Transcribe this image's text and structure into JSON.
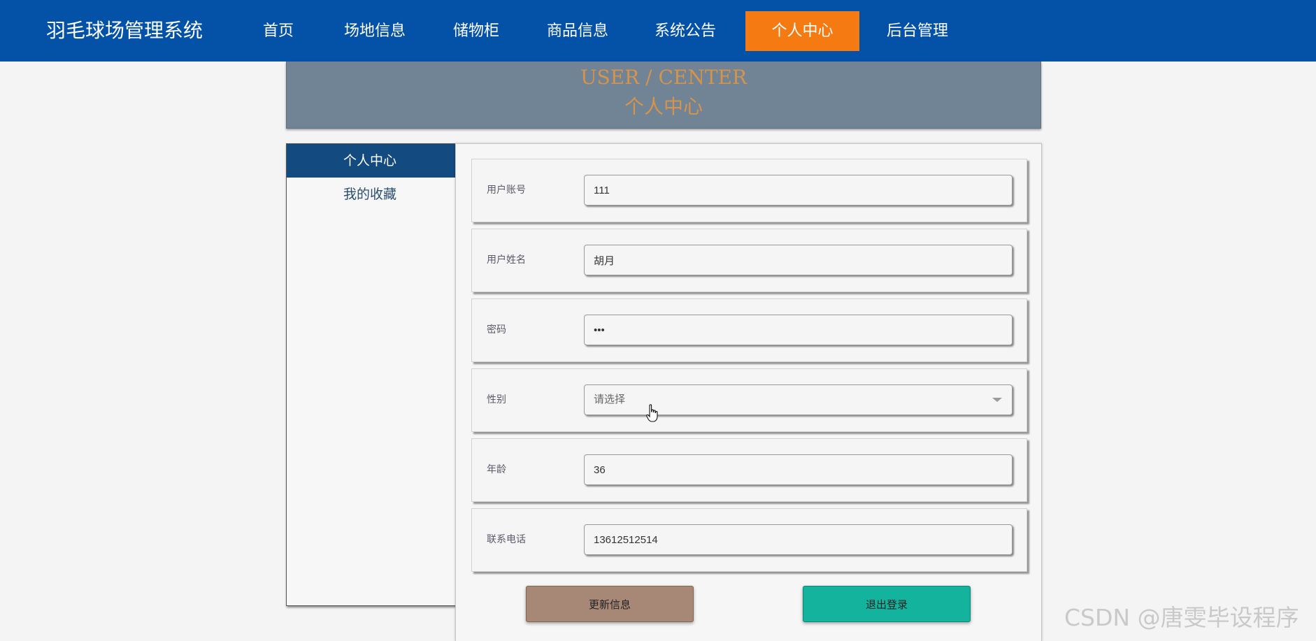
{
  "header": {
    "brand": "羽毛球场管理系统",
    "nav": [
      {
        "label": "首页",
        "active": false
      },
      {
        "label": "场地信息",
        "active": false
      },
      {
        "label": "储物柜",
        "active": false
      },
      {
        "label": "商品信息",
        "active": false
      },
      {
        "label": "系统公告",
        "active": false
      },
      {
        "label": "个人中心",
        "active": true
      },
      {
        "label": "后台管理",
        "active": false
      }
    ]
  },
  "banner": {
    "title_en": "USER / CENTER",
    "title_cn": "个人中心"
  },
  "sidebar": {
    "items": [
      {
        "label": "个人中心",
        "active": true
      },
      {
        "label": "我的收藏",
        "active": false
      }
    ]
  },
  "form": {
    "account": {
      "label": "用户账号",
      "value": "111"
    },
    "name": {
      "label": "用户姓名",
      "value": "胡月"
    },
    "password": {
      "label": "密码",
      "value": "•••"
    },
    "gender": {
      "label": "性别",
      "placeholder": "请选择"
    },
    "age": {
      "label": "年龄",
      "value": "36"
    },
    "phone": {
      "label": "联系电话",
      "value": "13612512514"
    }
  },
  "actions": {
    "update_label": "更新信息",
    "logout_label": "退出登录"
  },
  "watermark": "CSDN @唐雯毕设程序",
  "colors": {
    "nav_bg": "#0451a8",
    "nav_active": "#f57a12",
    "banner_bg": "#708495",
    "banner_text": "#d5934b",
    "side_active": "#134a80",
    "update_button": "#a78775",
    "logout_button": "#13b39e"
  }
}
